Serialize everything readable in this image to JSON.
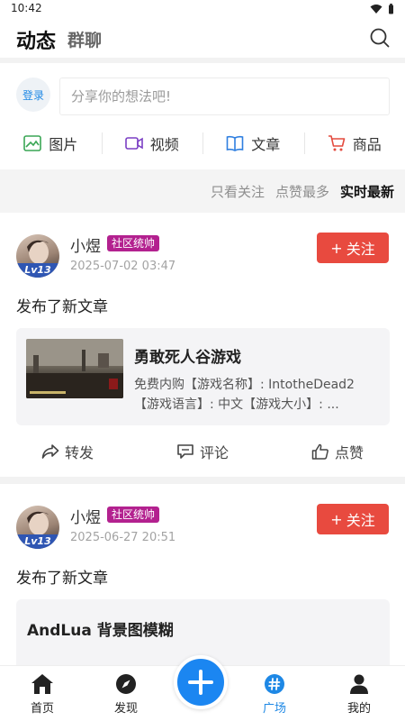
{
  "status_bar": {
    "time": "10:42"
  },
  "header": {
    "tab_active": "动态",
    "tab_other": "群聊"
  },
  "composer": {
    "login_label": "登录",
    "placeholder": "分享你的想法吧!",
    "media": [
      {
        "label": "图片",
        "icon": "image-icon",
        "color": "#3aa655"
      },
      {
        "label": "视频",
        "icon": "video-icon",
        "color": "#7b3fc4"
      },
      {
        "label": "文章",
        "icon": "book-icon",
        "color": "#2f7fe0"
      },
      {
        "label": "商品",
        "icon": "cart-icon",
        "color": "#e44b3f"
      }
    ]
  },
  "filters": {
    "options": [
      "只看关注",
      "点赞最多",
      "实时最新"
    ],
    "active": "实时最新"
  },
  "posts": [
    {
      "author": "小煜",
      "badge": "社区统帅",
      "level": "Lv13",
      "timestamp": "2025-07-02 03:47",
      "follow_label": "关注",
      "text": "发布了新文章",
      "article": {
        "title": "勇敢死人谷游戏",
        "desc_line1": "免费内购【游戏名称】: IntotheDead2",
        "desc_line2": "【游戏语言】: 中文【游戏大小】: ..."
      },
      "actions": {
        "share": "转发",
        "comment": "评论",
        "like": "点赞"
      }
    },
    {
      "author": "小煜",
      "badge": "社区统帅",
      "level": "Lv13",
      "timestamp": "2025-06-27 20:51",
      "follow_label": "关注",
      "text": "发布了新文章",
      "article": {
        "title": "AndLua 背景图模糊"
      }
    }
  ],
  "bottom_nav": {
    "items": [
      {
        "label": "首页",
        "icon": "home-icon"
      },
      {
        "label": "发现",
        "icon": "compass-icon"
      },
      {
        "label": "广场",
        "icon": "hashtag-icon"
      },
      {
        "label": "我的",
        "icon": "person-icon"
      }
    ],
    "active": "广场"
  },
  "colors": {
    "accent": "#1e88e5",
    "follow": "#e84a3f",
    "badge": "#b3218f"
  }
}
